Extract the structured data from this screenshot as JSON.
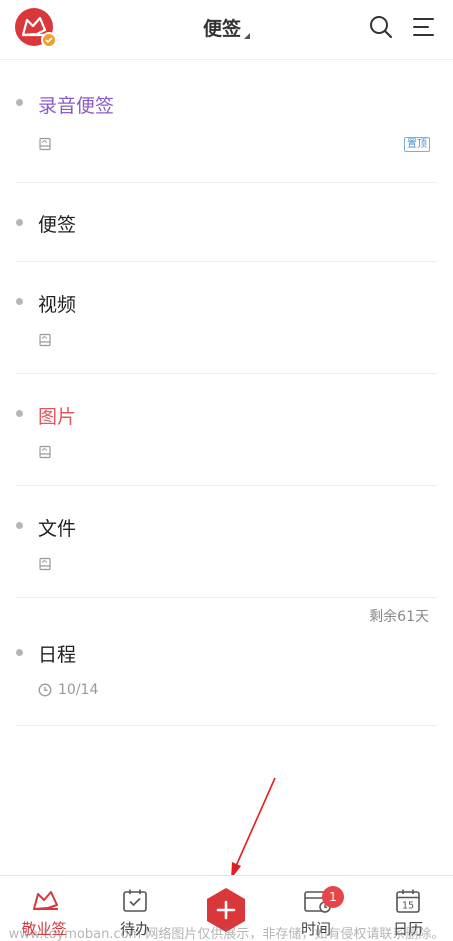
{
  "header": {
    "title": "便签"
  },
  "notes": [
    {
      "title": "录音便签",
      "color": "#8a5cc7",
      "pinned_label": "置顶",
      "has_attachment": true
    },
    {
      "title": "便签",
      "color": "#222222",
      "has_attachment": false
    },
    {
      "title": "视频",
      "color": "#222222",
      "has_attachment": true
    },
    {
      "title": "图片",
      "color": "#e2575c",
      "has_attachment": true
    },
    {
      "title": "文件",
      "color": "#222222",
      "has_attachment": true
    },
    {
      "title": "日程",
      "color": "#222222",
      "remaining": "剩余61天",
      "date": "10/14"
    }
  ],
  "bottom_nav": {
    "items": [
      {
        "label": "敬业签",
        "active": true
      },
      {
        "label": "待办",
        "active": false
      },
      {
        "label": "时间",
        "active": false,
        "badge": "1"
      },
      {
        "label": "日历",
        "active": false,
        "calendar_day": "15"
      }
    ]
  },
  "watermark": "www.toymoban.com 网络图片仅供展示，非存储，如有侵权请联系删除。",
  "colors": {
    "accent": "#d9373a",
    "divider": "#eeeeee",
    "muted": "#999999"
  }
}
